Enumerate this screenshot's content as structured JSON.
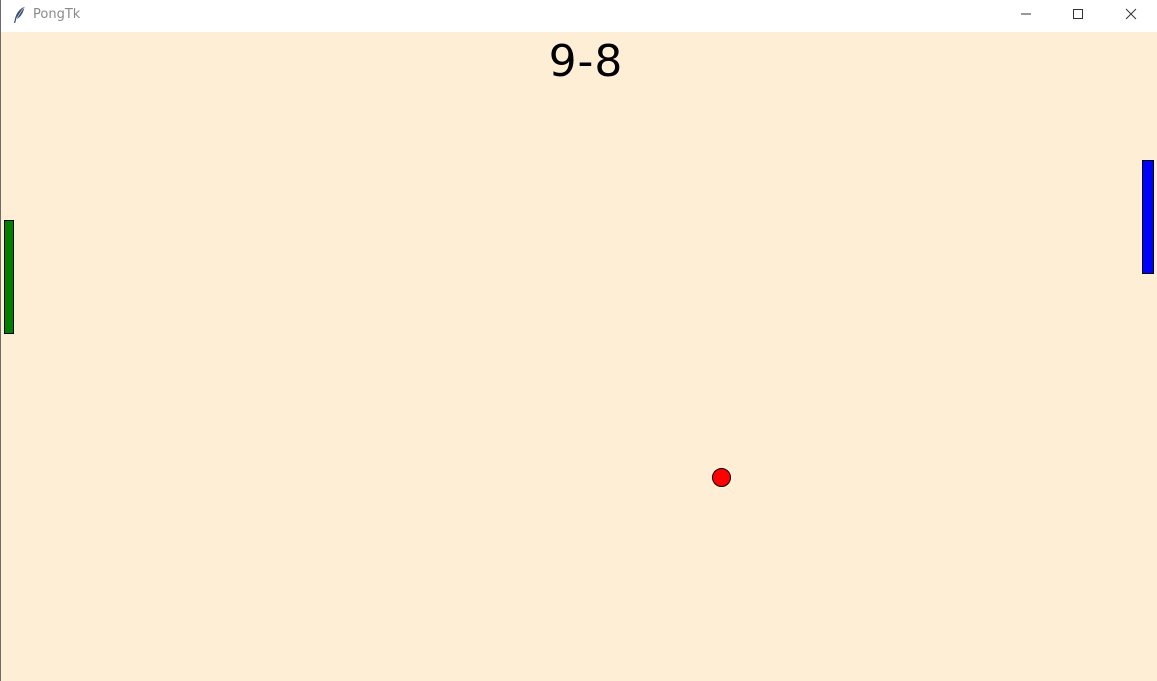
{
  "window": {
    "title": "PongTk",
    "icon": "feather-icon",
    "controls": {
      "minimize_icon": "minimize-icon",
      "maximize_icon": "maximize-icon",
      "close_icon": "close-icon"
    }
  },
  "game": {
    "score": "9-8",
    "background_color": "#ffeed6",
    "left_paddle_color": "#008000",
    "right_paddle_color": "#0000ff",
    "ball_color": "#ff0000"
  }
}
